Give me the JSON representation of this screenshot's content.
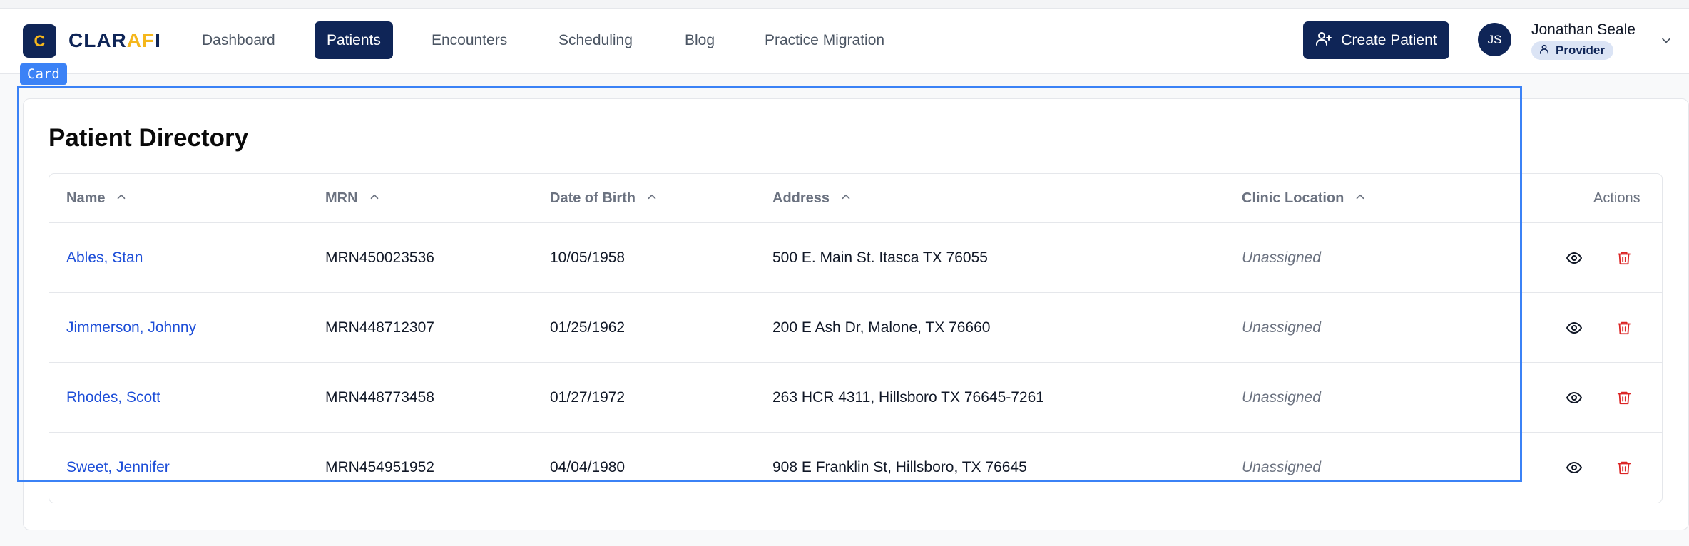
{
  "app": {
    "logo_letter": "C",
    "logo_prefix": "CLAR",
    "logo_accent": "AF",
    "logo_suffix": "I"
  },
  "nav": {
    "items": [
      {
        "label": "Dashboard",
        "active": false
      },
      {
        "label": "Patients",
        "active": true
      },
      {
        "label": "Encounters",
        "active": false
      },
      {
        "label": "Scheduling",
        "active": false
      },
      {
        "label": "Blog",
        "active": false
      },
      {
        "label": "Practice Migration",
        "active": false
      }
    ],
    "create_button": "Create Patient"
  },
  "user": {
    "initials": "JS",
    "name": "Jonathan Seale",
    "role": "Provider"
  },
  "overlay": {
    "tag": "Card"
  },
  "directory": {
    "title": "Patient Directory",
    "columns": {
      "name": "Name",
      "mrn": "MRN",
      "dob": "Date of Birth",
      "address": "Address",
      "location": "Clinic Location",
      "actions": "Actions"
    },
    "rows": [
      {
        "name": "Ables, Stan",
        "mrn": "MRN450023536",
        "dob": "10/05/1958",
        "address": "500 E. Main St. Itasca TX 76055",
        "location": "Unassigned"
      },
      {
        "name": "Jimmerson, Johnny",
        "mrn": "MRN448712307",
        "dob": "01/25/1962",
        "address": "200 E Ash Dr, Malone, TX 76660",
        "location": "Unassigned"
      },
      {
        "name": "Rhodes, Scott",
        "mrn": "MRN448773458",
        "dob": "01/27/1972",
        "address": "263 HCR 4311, Hillsboro TX 76645-7261",
        "location": "Unassigned"
      },
      {
        "name": "Sweet, Jennifer",
        "mrn": "MRN454951952",
        "dob": "04/04/1980",
        "address": "908 E Franklin St, Hillsboro, TX 76645",
        "location": "Unassigned"
      }
    ]
  },
  "icons": {
    "view": "eye-icon",
    "delete": "trash-icon",
    "sort": "chevron-up-icon",
    "add_user": "user-plus-icon",
    "role": "user-icon",
    "menu": "chevron-down-icon"
  },
  "colors": {
    "brand": "#0f2557",
    "accent": "#f5b71c",
    "link": "#1d4ed8",
    "danger": "#dc2626",
    "highlight": "#3b82f6"
  }
}
